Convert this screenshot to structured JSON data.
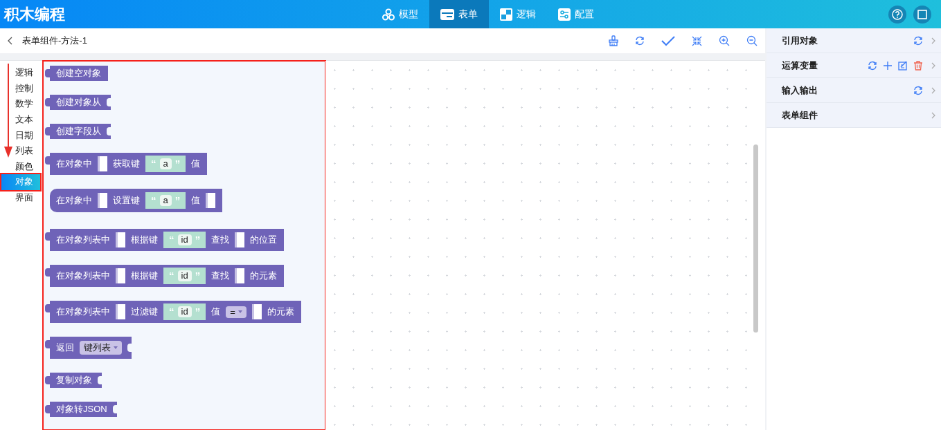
{
  "app": {
    "title": "积木编程"
  },
  "nav_tabs": [
    {
      "label": "模型",
      "selected": false
    },
    {
      "label": "表单",
      "selected": true
    },
    {
      "label": "逻辑",
      "selected": false
    },
    {
      "label": "配置",
      "selected": false
    }
  ],
  "page": {
    "title": "表单组件-方法-1"
  },
  "categories": [
    {
      "label": "逻辑",
      "selected": false,
      "outlined": false
    },
    {
      "label": "控制",
      "selected": false,
      "outlined": false
    },
    {
      "label": "数学",
      "selected": false,
      "outlined": false
    },
    {
      "label": "文本",
      "selected": false,
      "outlined": false
    },
    {
      "label": "日期",
      "selected": false,
      "outlined": false
    },
    {
      "label": "列表",
      "selected": false,
      "outlined": false
    },
    {
      "label": "颜色",
      "selected": false,
      "outlined": false
    },
    {
      "label": "对象",
      "selected": true,
      "outlined": true
    },
    {
      "label": "界面",
      "selected": false,
      "outlined": false
    }
  ],
  "flyout": {
    "outlined": true,
    "blocks": [
      {
        "kind": "value",
        "open_end": false,
        "parts": [
          {
            "kind": "text",
            "text": "创建空对象"
          }
        ]
      },
      {
        "kind": "value",
        "open_end": true,
        "parts": [
          {
            "kind": "text",
            "text": "创建对象从"
          }
        ]
      },
      {
        "kind": "value",
        "open_end": true,
        "parts": [
          {
            "kind": "text",
            "text": "创建字段从"
          }
        ]
      },
      {
        "kind": "value",
        "open_end": false,
        "parts": [
          {
            "kind": "text",
            "text": "在对象中"
          },
          {
            "kind": "socket"
          },
          {
            "kind": "text",
            "text": "获取键"
          },
          {
            "kind": "string",
            "quote_open": "“",
            "value": "a",
            "quote_close": "”"
          },
          {
            "kind": "text",
            "text": "值"
          }
        ]
      },
      {
        "kind": "statement",
        "open_end": false,
        "parts": [
          {
            "kind": "text",
            "text": "在对象中"
          },
          {
            "kind": "socket"
          },
          {
            "kind": "text",
            "text": "设置键"
          },
          {
            "kind": "string",
            "quote_open": "“",
            "value": "a",
            "quote_close": "”"
          },
          {
            "kind": "text",
            "text": "值"
          },
          {
            "kind": "socket"
          }
        ]
      },
      {
        "kind": "value",
        "open_end": false,
        "parts": [
          {
            "kind": "text",
            "text": "在对象列表中"
          },
          {
            "kind": "socket"
          },
          {
            "kind": "text",
            "text": "根据键"
          },
          {
            "kind": "string",
            "quote_open": "“",
            "value": "id",
            "quote_close": "”"
          },
          {
            "kind": "text",
            "text": "查找"
          },
          {
            "kind": "socket"
          },
          {
            "kind": "text",
            "text": "的位置"
          }
        ]
      },
      {
        "kind": "value",
        "open_end": false,
        "parts": [
          {
            "kind": "text",
            "text": "在对象列表中"
          },
          {
            "kind": "socket"
          },
          {
            "kind": "text",
            "text": "根据键"
          },
          {
            "kind": "string",
            "quote_open": "“",
            "value": "id",
            "quote_close": "”"
          },
          {
            "kind": "text",
            "text": "查找"
          },
          {
            "kind": "socket"
          },
          {
            "kind": "text",
            "text": "的元素"
          }
        ]
      },
      {
        "kind": "value",
        "open_end": false,
        "parts": [
          {
            "kind": "text",
            "text": "在对象列表中"
          },
          {
            "kind": "socket"
          },
          {
            "kind": "text",
            "text": "过滤键"
          },
          {
            "kind": "string",
            "quote_open": "“",
            "value": "id",
            "quote_close": "”"
          },
          {
            "kind": "text",
            "text": "值"
          },
          {
            "kind": "dropdown",
            "value": "="
          },
          {
            "kind": "socket"
          },
          {
            "kind": "text",
            "text": "的元素"
          }
        ]
      },
      {
        "kind": "value",
        "open_end": true,
        "parts": [
          {
            "kind": "text",
            "text": "返回"
          },
          {
            "kind": "dropdown",
            "value": "键列表"
          }
        ]
      },
      {
        "kind": "value",
        "open_end": true,
        "parts": [
          {
            "kind": "text",
            "text": "复制对象"
          }
        ]
      },
      {
        "kind": "value",
        "open_end": true,
        "parts": [
          {
            "kind": "text",
            "text": "对象转JSON"
          }
        ]
      }
    ]
  },
  "side_panel": [
    {
      "title": "引用对象",
      "tools": [
        {
          "kind": "refresh"
        }
      ]
    },
    {
      "title": "运算变量",
      "tools": [
        {
          "kind": "refresh"
        },
        {
          "kind": "add"
        },
        {
          "kind": "edit"
        },
        {
          "kind": "delete"
        }
      ]
    },
    {
      "title": "输入输出",
      "tools": [
        {
          "kind": "refresh"
        }
      ]
    },
    {
      "title": "表单组件"
    }
  ]
}
